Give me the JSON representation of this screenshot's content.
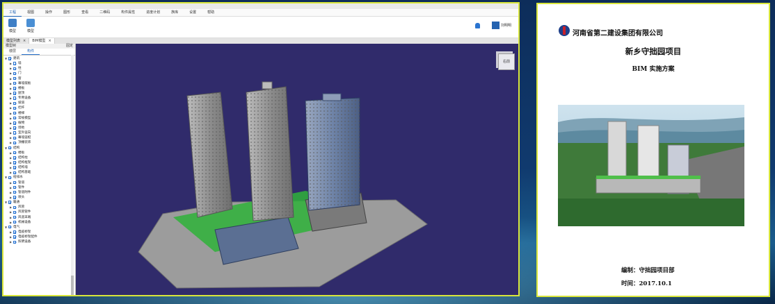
{
  "app": {
    "title": "",
    "menu": [
      "工程",
      "视图",
      "操作",
      "图形",
      "查看",
      "二维码",
      "构件属性",
      "进度计划",
      "族库",
      "设置",
      "帮助"
    ],
    "ribbon_buttons": [
      "模型",
      "模型"
    ],
    "user_name": "刘明明",
    "doc_tabs": [
      {
        "label": "模型列表",
        "close": "×"
      },
      {
        "label": "BIM模型",
        "close": "×"
      }
    ],
    "panel_title": "模型树",
    "panel_pin": "固定",
    "subtabs": [
      "楼层",
      "构件"
    ],
    "tree": [
      {
        "level": 0,
        "arrow": "▼",
        "label": "建筑"
      },
      {
        "level": 1,
        "arrow": "▶",
        "label": "墙"
      },
      {
        "level": 1,
        "arrow": "▶",
        "label": "柱"
      },
      {
        "level": 1,
        "arrow": "▶",
        "label": "门"
      },
      {
        "level": 1,
        "arrow": "▶",
        "label": "窗"
      },
      {
        "level": 1,
        "arrow": "▶",
        "label": "幕墙嵌板"
      },
      {
        "level": 1,
        "arrow": "▶",
        "label": "楼板"
      },
      {
        "level": 1,
        "arrow": "▶",
        "label": "屋顶"
      },
      {
        "level": 1,
        "arrow": "▶",
        "label": "专用设备"
      },
      {
        "level": 1,
        "arrow": "▶",
        "label": "坡道"
      },
      {
        "level": 1,
        "arrow": "▶",
        "label": "栏杆"
      },
      {
        "level": 1,
        "arrow": "▶",
        "label": "楼梯"
      },
      {
        "level": 1,
        "arrow": "▶",
        "label": "常规模型"
      },
      {
        "level": 1,
        "arrow": "▶",
        "label": "植物"
      },
      {
        "level": 1,
        "arrow": "▶",
        "label": "场地"
      },
      {
        "level": 1,
        "arrow": "▶",
        "label": "室外竖向"
      },
      {
        "level": 1,
        "arrow": "▶",
        "label": "幕墙竖梃"
      },
      {
        "level": 1,
        "arrow": "▶",
        "label": "顶棚装饰"
      },
      {
        "level": 0,
        "arrow": "▼",
        "label": "结构"
      },
      {
        "level": 1,
        "arrow": "▶",
        "label": "楼板"
      },
      {
        "level": 1,
        "arrow": "▶",
        "label": "结构柱"
      },
      {
        "level": 1,
        "arrow": "▶",
        "label": "结构框架"
      },
      {
        "level": 1,
        "arrow": "▶",
        "label": "结构墙"
      },
      {
        "level": 1,
        "arrow": "▶",
        "label": "结构基础"
      },
      {
        "level": 0,
        "arrow": "▼",
        "label": "给排水"
      },
      {
        "level": 1,
        "arrow": "▶",
        "label": "管道"
      },
      {
        "level": 1,
        "arrow": "▶",
        "label": "管件"
      },
      {
        "level": 1,
        "arrow": "▶",
        "label": "管道附件"
      },
      {
        "level": 1,
        "arrow": "▶",
        "label": "喷头"
      },
      {
        "level": 0,
        "arrow": "▼",
        "label": "暖通"
      },
      {
        "level": 1,
        "arrow": "▶",
        "label": "风管"
      },
      {
        "level": 1,
        "arrow": "▶",
        "label": "风管管件"
      },
      {
        "level": 1,
        "arrow": "▶",
        "label": "风道末端"
      },
      {
        "level": 1,
        "arrow": "▶",
        "label": "机械设备"
      },
      {
        "level": 0,
        "arrow": "▼",
        "label": "电气"
      },
      {
        "level": 1,
        "arrow": "▶",
        "label": "电缆桥架"
      },
      {
        "level": 1,
        "arrow": "▶",
        "label": "电缆桥架配件"
      },
      {
        "level": 1,
        "arrow": "▶",
        "label": "照明设备"
      }
    ],
    "nav_cube_label": "右前",
    "colors": {
      "viewport_bg": "#302b6b",
      "accent": "#2a74d0",
      "frame": "#d9e63a",
      "ground": "#9a9a9a",
      "lawn": "#2fb33a"
    }
  },
  "document": {
    "company": "河南省第二建设集团有限公司",
    "title": "新乡守拙园项目",
    "subtitle": "BIM 实施方案",
    "editor": "编制：守拙园项目部",
    "date": "时间：2017.10.1"
  }
}
